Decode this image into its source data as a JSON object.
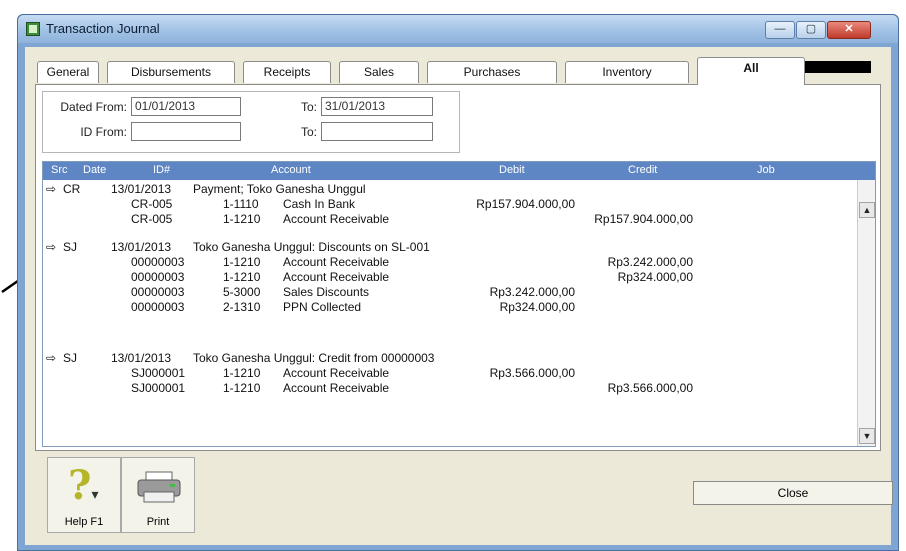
{
  "window": {
    "title": "Transaction Journal",
    "min_label": "—",
    "max_label": "▢",
    "close_label": "✕"
  },
  "tabs": [
    {
      "label": "General"
    },
    {
      "label": "Disbursements"
    },
    {
      "label": "Receipts"
    },
    {
      "label": "Sales"
    },
    {
      "label": "Purchases"
    },
    {
      "label": "Inventory"
    },
    {
      "label": "All"
    }
  ],
  "active_tab": "All",
  "filters": {
    "dated_from_label": "Dated From:",
    "dated_from_value": "01/01/2013",
    "to_label_1": "To:",
    "to_value_1": "31/01/2013",
    "id_from_label": "ID From:",
    "id_from_value": "",
    "to_label_2": "To:",
    "to_value_2": ""
  },
  "grid": {
    "columns": [
      "Src",
      "Date",
      "ID#",
      "Account",
      "Debit",
      "Credit",
      "Job"
    ],
    "groups": [
      {
        "icon": "⇨",
        "src": "CR",
        "date": "13/01/2013",
        "memo": "Payment; Toko Ganesha Unggul",
        "lines": [
          {
            "id": "CR-005",
            "acct": "1-1110",
            "name": "Cash In Bank",
            "debit": "Rp157.904.000,00",
            "credit": ""
          },
          {
            "id": "CR-005",
            "acct": "1-1210",
            "name": "Account Receivable",
            "debit": "",
            "credit": "Rp157.904.000,00"
          }
        ]
      },
      {
        "icon": "⇨",
        "src": "SJ",
        "date": "13/01/2013",
        "memo": "Toko Ganesha Unggul: Discounts on SL-001",
        "lines": [
          {
            "id": "00000003",
            "acct": "1-1210",
            "name": "Account Receivable",
            "debit": "",
            "credit": "Rp3.242.000,00"
          },
          {
            "id": "00000003",
            "acct": "1-1210",
            "name": "Account Receivable",
            "debit": "",
            "credit": "Rp324.000,00"
          },
          {
            "id": "00000003",
            "acct": "5-3000",
            "name": "Sales Discounts",
            "debit": "Rp3.242.000,00",
            "credit": ""
          },
          {
            "id": "00000003",
            "acct": "2-1310",
            "name": "PPN Collected",
            "debit": "Rp324.000,00",
            "credit": ""
          }
        ]
      },
      {
        "icon": "⇨",
        "src": "SJ",
        "date": "13/01/2013",
        "memo": "Toko Ganesha Unggul: Credit from 00000003",
        "lines": [
          {
            "id": "SJ000001",
            "acct": "1-1210",
            "name": "Account Receivable",
            "debit": "Rp3.566.000,00",
            "credit": ""
          },
          {
            "id": "SJ000001",
            "acct": "1-1210",
            "name": "Account Receivable",
            "debit": "",
            "credit": "Rp3.566.000,00"
          }
        ]
      }
    ]
  },
  "buttons": {
    "help_label": "Help F1",
    "print_label": "Print",
    "close_label": "Close"
  },
  "colors": {
    "grid_header": "#5f86c4",
    "window_frame": "#7fa6d2"
  }
}
